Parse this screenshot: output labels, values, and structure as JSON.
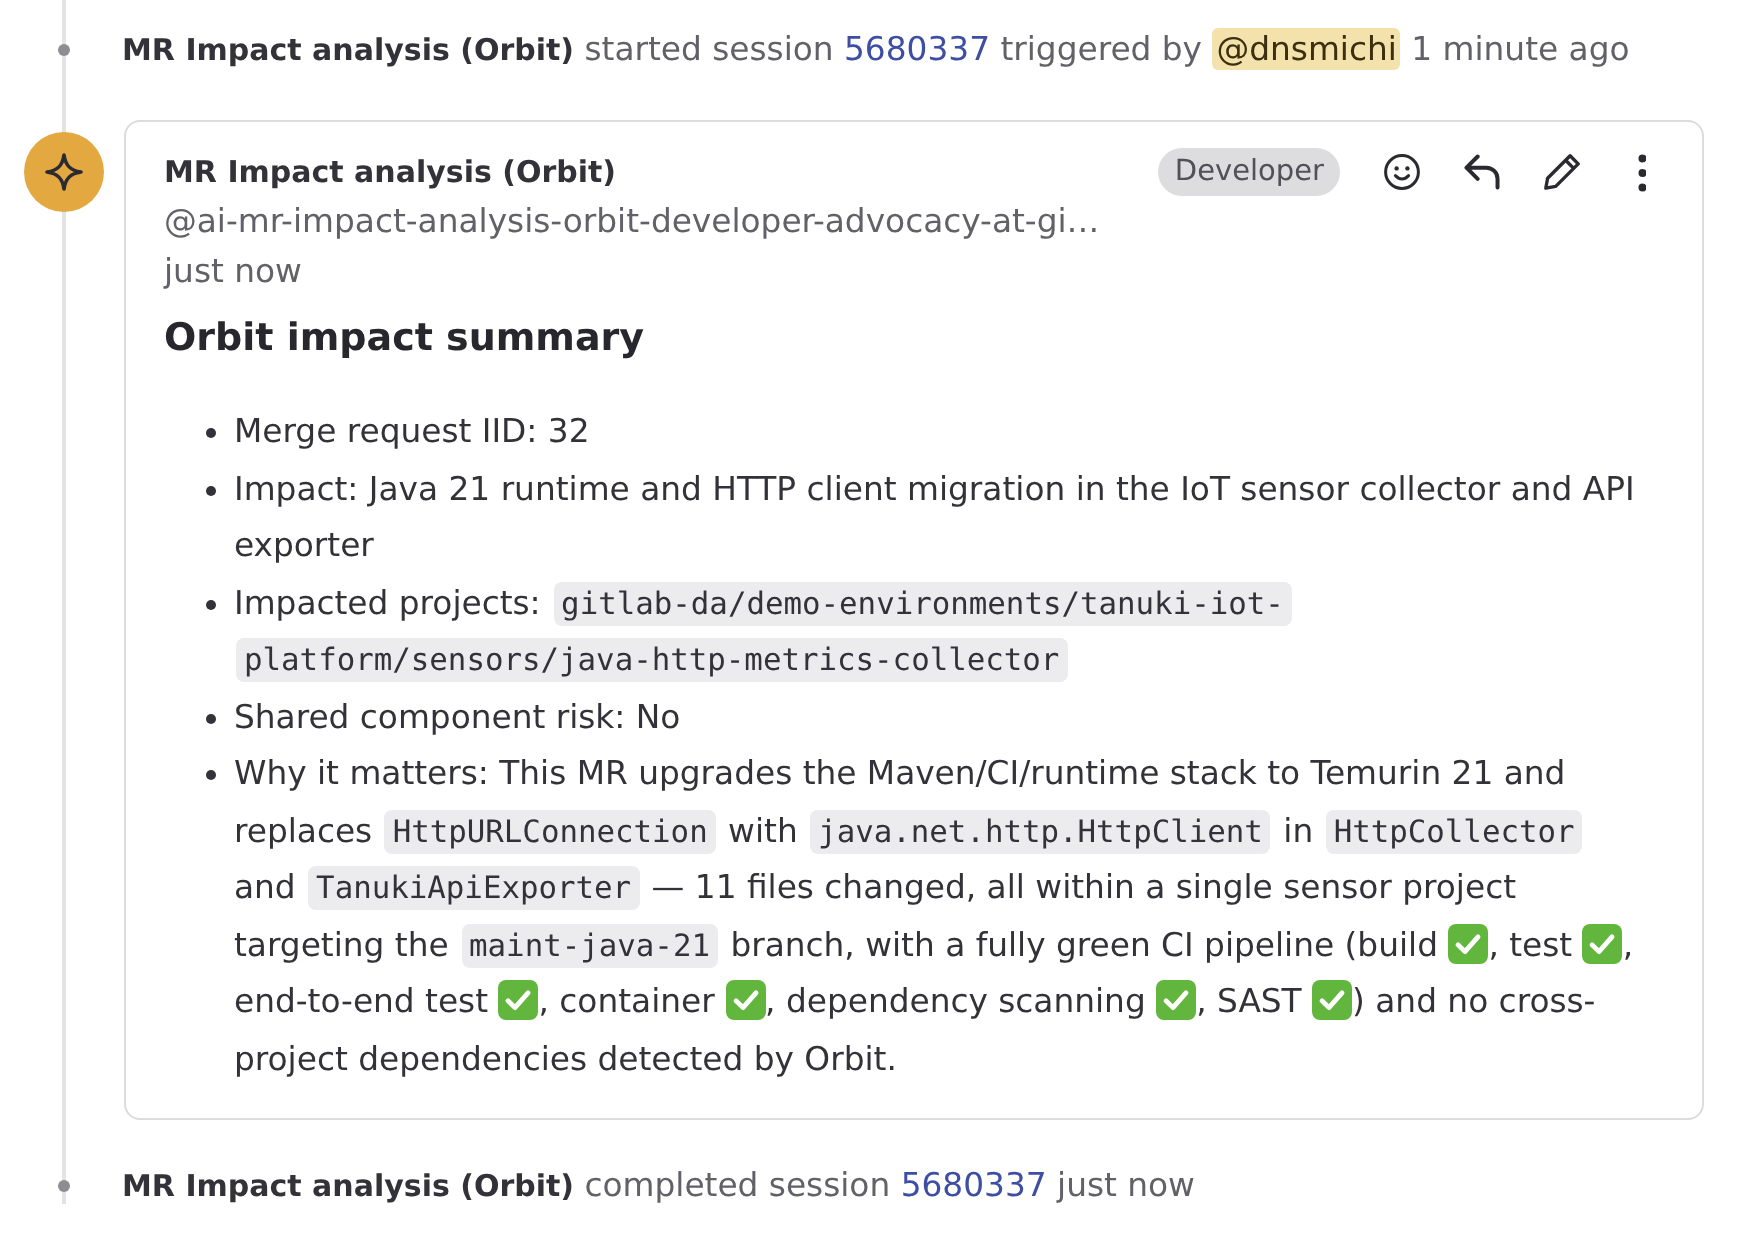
{
  "start_event": {
    "parts": [
      {
        "kind": "bold",
        "text": "MR Impact analysis (Orbit)"
      },
      {
        "kind": "text",
        "text": " started session "
      },
      {
        "kind": "link",
        "text": "5680337"
      },
      {
        "kind": "text",
        "text": " triggered by "
      },
      {
        "kind": "mention",
        "text": "@dnsmichi"
      },
      {
        "kind": "text",
        "text": " 1 minute ago"
      }
    ]
  },
  "comment": {
    "author": "MR Impact analysis (Orbit)",
    "username": "@ai-mr-impact-analysis-orbit-developer-advocacy-at-gi…",
    "time": "just now",
    "role_badge": "Developer",
    "heading": "Orbit impact summary",
    "items": [
      {
        "parts": [
          {
            "kind": "text",
            "text": "Merge request IID: 32"
          }
        ]
      },
      {
        "parts": [
          {
            "kind": "text",
            "text": "Impact: Java 21 runtime and HTTP client migration in the IoT sensor collector and API exporter"
          }
        ]
      },
      {
        "parts": [
          {
            "kind": "text",
            "text": "Impacted projects: "
          },
          {
            "kind": "code",
            "text": "gitlab-da/demo-environments/tanuki-iot-"
          },
          {
            "kind": "code",
            "text": "platform/sensors/java-http-metrics-collector"
          }
        ]
      },
      {
        "parts": [
          {
            "kind": "text",
            "text": "Shared component risk: No"
          }
        ]
      },
      {
        "parts": [
          {
            "kind": "text",
            "text": "Why it matters: This MR upgrades the Maven/CI/runtime stack to Temurin 21 and replaces "
          },
          {
            "kind": "code",
            "text": "HttpURLConnection"
          },
          {
            "kind": "text",
            "text": " with "
          },
          {
            "kind": "code",
            "text": "java.net.http.HttpClient"
          },
          {
            "kind": "text",
            "text": " in "
          },
          {
            "kind": "code",
            "text": "HttpCollector"
          },
          {
            "kind": "text",
            "text": " and "
          },
          {
            "kind": "code",
            "text": "TanukiApiExporter"
          },
          {
            "kind": "text",
            "text": " — 11 files changed, all within a single sensor project targeting the "
          },
          {
            "kind": "code",
            "text": "maint-java-21"
          },
          {
            "kind": "text",
            "text": " branch, with a fully green CI pipeline (build "
          },
          {
            "kind": "check"
          },
          {
            "kind": "text",
            "text": ", test "
          },
          {
            "kind": "check"
          },
          {
            "kind": "text",
            "text": ", end-to-end test "
          },
          {
            "kind": "check"
          },
          {
            "kind": "text",
            "text": ", container "
          },
          {
            "kind": "check"
          },
          {
            "kind": "text",
            "text": ", dependency scanning "
          },
          {
            "kind": "check"
          },
          {
            "kind": "text",
            "text": ", SAST "
          },
          {
            "kind": "check"
          },
          {
            "kind": "text",
            "text": ") and no cross-project dependencies detected by Orbit."
          }
        ]
      }
    ]
  },
  "end_event": {
    "parts": [
      {
        "kind": "bold",
        "text": "MR Impact analysis (Orbit)"
      },
      {
        "kind": "text",
        "text": " completed session "
      },
      {
        "kind": "link",
        "text": "5680337"
      },
      {
        "kind": "text",
        "text": " just now"
      }
    ]
  }
}
